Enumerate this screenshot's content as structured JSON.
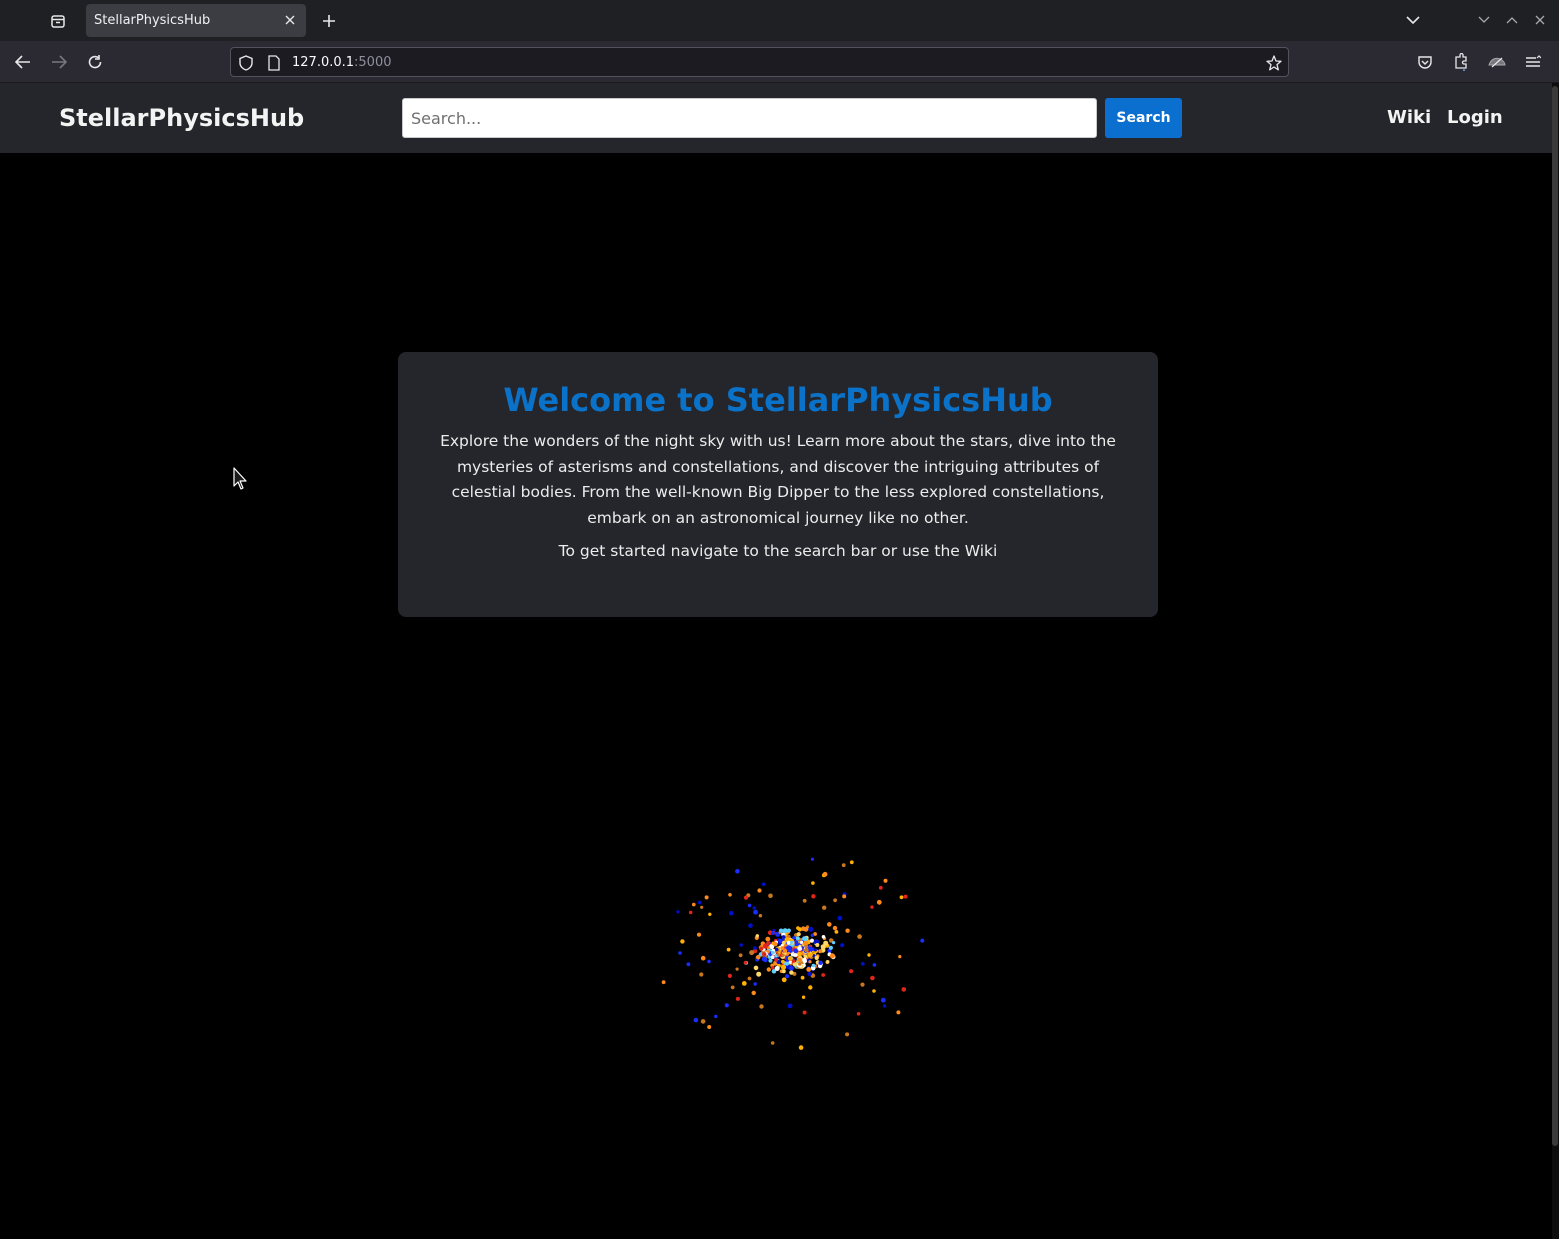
{
  "browser": {
    "tab_title": "StellarPhysicsHub",
    "url_host": "127.0.0.1",
    "url_port": ":5000"
  },
  "header": {
    "brand": "StellarPhysicsHub",
    "search_placeholder": "Search...",
    "search_button": "Search",
    "nav_links": [
      "Wiki",
      "Login"
    ]
  },
  "welcome": {
    "title": "Welcome to StellarPhysicsHub",
    "intro": "Explore the wonders of the night sky with us! Learn more about the stars, dive into the mysteries of asterisms and constellations, and discover the intriguing attributes of celestial bodies. From the well-known Big Dipper to the less explored constellations, embark on an astronomical journey like no other.",
    "hint": "To get started navigate to the search bar or use the Wiki"
  },
  "colors": {
    "accent": "#0b6fcf",
    "title_blue": "#0b72c9",
    "header_bg": "#25262b",
    "page_bg": "#000000",
    "star_colors": [
      "#1a2dff",
      "#0010c8",
      "#ff8a1c",
      "#ffb000",
      "#e0261b",
      "#c9771f",
      "#ffd86a",
      "#5fd0ff",
      "#ffffff"
    ]
  },
  "icons": [
    "tab-list-icon",
    "close-icon",
    "plus-icon",
    "chevron-down-icon",
    "minimize-icon",
    "maximize-icon",
    "back-icon",
    "forward-icon",
    "reload-icon",
    "shield-icon",
    "page-icon",
    "star-icon",
    "pocket-icon",
    "extensions-icon",
    "account-icon",
    "menu-icon"
  ]
}
